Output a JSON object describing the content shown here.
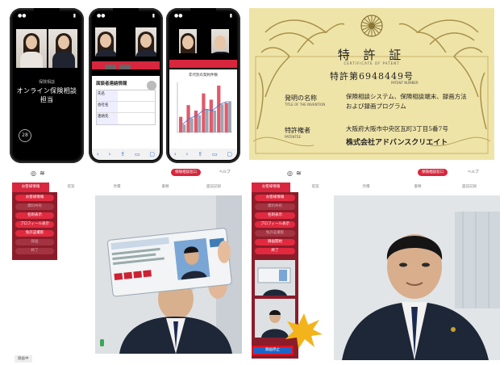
{
  "phone1": {
    "subtitle": "保険相談",
    "title": "オンライン保険相談 担当",
    "corner_button": "28"
  },
  "phone2": {
    "heading": "面談者連絡情報",
    "rows": [
      "氏名",
      "会社名",
      "連絡先"
    ]
  },
  "phone3": {
    "heading": "年代別の契約件数",
    "bars": [
      20,
      35,
      28,
      50,
      42,
      60,
      38
    ],
    "line": [
      10,
      18,
      22,
      30,
      28,
      36,
      40
    ]
  },
  "certificate": {
    "title": "特 許 証",
    "title_en": "CERTIFICATE OF PATENT",
    "number": "特許第6948449号",
    "number_en": "PATENT NUMBER",
    "invention_label": "発明の名称",
    "invention_label_en": "TITLE OF THE INVENTION",
    "invention_value_1": "保険相談システム、保険相談端末、録画方法",
    "invention_value_2": "および録画プログラム",
    "holder_label": "特許権者",
    "holder_label_en": "PATENTEE",
    "holder_address": "大阪府大阪市中央区瓦町3丁目5番7号",
    "holder_name": "株式会社アドバンスクリエイト"
  },
  "left_screen": {
    "header_button": "保険相談窓口",
    "header_link": "ヘルプ",
    "tabs": [
      "お客様情報",
      "提案",
      "見積",
      "書類",
      "面談記録"
    ],
    "side_buttons": [
      {
        "label": "お客様情報",
        "on": true
      },
      {
        "label": "資料共有",
        "on": false
      },
      {
        "label": "名刺表示",
        "on": true
      },
      {
        "label": "プロフィール表示",
        "on": true
      },
      {
        "label": "免許証撮影",
        "on": true
      },
      {
        "label": "録画",
        "on": false
      },
      {
        "label": "終了",
        "on": false
      }
    ],
    "footer_button": "録画中"
  },
  "right_screen": {
    "header_button": "保険相談窓口",
    "header_link": "ヘルプ",
    "tabs": [
      "お客様情報",
      "提案",
      "見積",
      "書類",
      "面談記録"
    ],
    "side_buttons": [
      {
        "label": "お客様情報",
        "on": true
      },
      {
        "label": "資料共有",
        "on": false
      },
      {
        "label": "名刺表示",
        "on": true
      },
      {
        "label": "プロフィール表示",
        "on": true
      },
      {
        "label": "免許証撮影",
        "on": false
      },
      {
        "label": "録画開始",
        "on": true
      },
      {
        "label": "終了",
        "on": true
      }
    ],
    "highlight_button": "録画停止",
    "highlight_color": "#e0101f",
    "burst_color": "#f3b31b"
  },
  "colors": {
    "brand_red": "#d7263d",
    "sidebar_dark": "#8b1c2a",
    "certificate_bg": "#efe4a8"
  }
}
